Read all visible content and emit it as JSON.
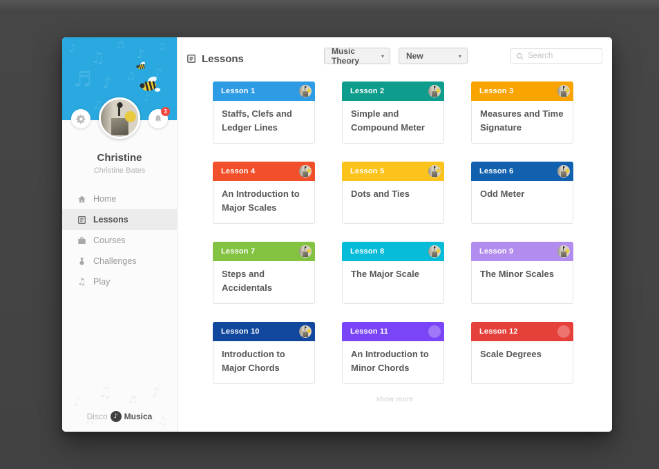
{
  "colors": {
    "page_bg": "#464646",
    "sidebar_header": "#2aa9e0",
    "notification_badge": "#f2453d"
  },
  "sidebar": {
    "profile": {
      "name": "Christine",
      "subtitle": "Christine Bates",
      "notification_count": "3"
    },
    "nav": [
      {
        "label": "Home",
        "icon": "home-icon",
        "active": false
      },
      {
        "label": "Lessons",
        "icon": "lessons-icon",
        "active": true
      },
      {
        "label": "Courses",
        "icon": "courses-icon",
        "active": false
      },
      {
        "label": "Challenges",
        "icon": "challenges-icon",
        "active": false
      },
      {
        "label": "Play",
        "icon": "play-icon",
        "active": false
      }
    ],
    "logo": {
      "prefix": "Disco",
      "suffix": "Musica"
    }
  },
  "header": {
    "title": "Lessons",
    "filters": [
      {
        "value": "Music Theory"
      },
      {
        "value": "New"
      }
    ],
    "search_placeholder": "Search"
  },
  "lessons": [
    {
      "badge": "Lesson 1",
      "title": "Staffs, Clefs and Ledger Lines",
      "color": "#2E9BE5",
      "avatar": true
    },
    {
      "badge": "Lesson 2",
      "title": "Simple and Compound Meter",
      "color": "#0E9D8C",
      "avatar": true
    },
    {
      "badge": "Lesson 3",
      "title": "Measures and Time Signature",
      "color": "#F9A400",
      "avatar": true
    },
    {
      "badge": "Lesson 4",
      "title": "An Introduction to Major Scales",
      "color": "#F1502A",
      "avatar": true
    },
    {
      "badge": "Lesson 5",
      "title": "Dots and Ties",
      "color": "#FBC31C",
      "avatar": true
    },
    {
      "badge": "Lesson 6",
      "title": "Odd Meter",
      "color": "#1261AE",
      "avatar": true
    },
    {
      "badge": "Lesson 7",
      "title": "Steps and Accidentals",
      "color": "#83C341",
      "avatar": true
    },
    {
      "badge": "Lesson 8",
      "title": "The Major Scale",
      "color": "#06BCD8",
      "avatar": true
    },
    {
      "badge": "Lesson 9",
      "title": "The Minor Scales",
      "color": "#B38CEF",
      "avatar": true
    },
    {
      "badge": "Lesson 10",
      "title": "Introduction to Major Chords",
      "color": "#11489E",
      "avatar": true
    },
    {
      "badge": "Lesson 11",
      "title": "An Introduction to Minor Chords",
      "color": "#7A45F6",
      "avatar": false
    },
    {
      "badge": "Lesson 12",
      "title": "Scale Degrees",
      "color": "#E6403A",
      "avatar": false
    }
  ],
  "footer": {
    "show_more": "show more"
  }
}
